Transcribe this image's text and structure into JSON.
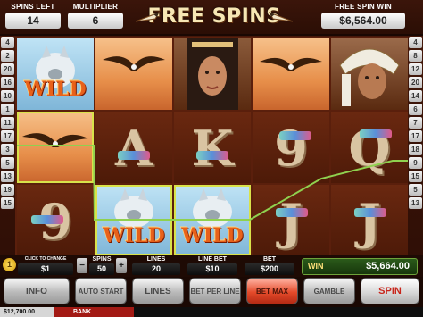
{
  "header": {
    "spins_left_label": "SPINS LEFT",
    "spins_left_value": "14",
    "multiplier_label": "MULTIPLIER",
    "multiplier_value": "6",
    "title": "FREE SPINS",
    "free_spin_win_label": "FREE SPIN WIN",
    "free_spin_win_value": "$6,564.00"
  },
  "reels": {
    "symbols": [
      [
        "wild-wolf",
        "eagle",
        "woman",
        "eagle",
        "chief"
      ],
      [
        "eagle",
        "A",
        "K",
        "9",
        "Q"
      ],
      [
        "9",
        "wild-wolf",
        "wild-wolf",
        "J",
        "J"
      ]
    ],
    "wild_label": "WILD"
  },
  "line_markers": {
    "left": [
      "4",
      "2",
      "20",
      "16",
      "10",
      "1",
      "11",
      "17",
      "3",
      "5",
      "13",
      "19",
      "15"
    ],
    "right": [
      "4",
      "8",
      "12",
      "20",
      "14",
      "6",
      "7",
      "17",
      "18",
      "9",
      "15",
      "5",
      "13"
    ]
  },
  "controls": {
    "coin_symbol": "1",
    "coin_label": "CLICK TO CHANGE",
    "coin_value": "$1",
    "spins_label": "SPINS",
    "spins_value": "50",
    "minus": "−",
    "plus": "+",
    "lines_label": "LINES",
    "lines_value": "20",
    "line_bet_label": "LINE BET",
    "line_bet_value": "$10",
    "bet_label": "BET",
    "bet_value": "$200",
    "win_label": "WIN",
    "win_value": "$5,664.00"
  },
  "buttons": {
    "info": "INFO",
    "auto_start": "AUTO START",
    "lines": "LINES",
    "bet_per_line": "BET PER LINE",
    "bet_max": "BET MAX",
    "gamble": "GAMBLE",
    "spin": "SPIN"
  },
  "status": {
    "balance": "$12,700.00",
    "bank": "BANK"
  },
  "colors": {
    "payline": "#8fd14f",
    "highlight": "#d9e24a",
    "wild_text": "#e8611a"
  }
}
